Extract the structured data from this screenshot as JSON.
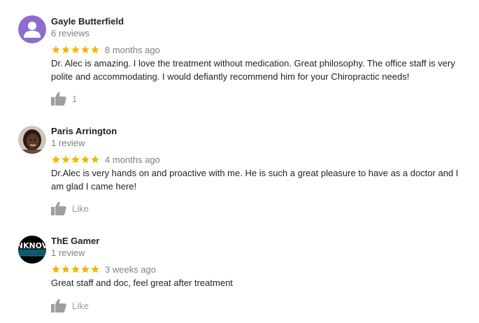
{
  "colors": {
    "star": "#F4B400",
    "thumb": "#9e9e9e",
    "avatar_purple": "#8e6ccf"
  },
  "reviews": [
    {
      "name": "Gayle Butterfield",
      "review_count": "6 reviews",
      "rating": 5,
      "date": "8 months ago",
      "text": "Dr. Alec is amazing.  I love the treatment without medication.  Great philosophy.  The office staff is very polite and accommodating.  I would defiantly recommend him for your Chiropractic needs!",
      "like_label": "1",
      "avatar_icon": "person-icon"
    },
    {
      "name": "Paris Arrington",
      "review_count": "1 review",
      "rating": 5,
      "date": "4 months ago",
      "text": "Dr.Alec is very hands on and proactive with me. He is such a great pleasure to have as a doctor and I am glad I came here!",
      "like_label": "Like",
      "avatar_icon": "profile-photo"
    },
    {
      "name": "ThE Gamer",
      "review_count": "1 review",
      "rating": 5,
      "date": "3 weeks ago",
      "text": "Great staff and doc, feel great after treatment",
      "like_label": "Like",
      "avatar_icon": "gamer-logo",
      "avatar_text": "NKNOV"
    }
  ]
}
